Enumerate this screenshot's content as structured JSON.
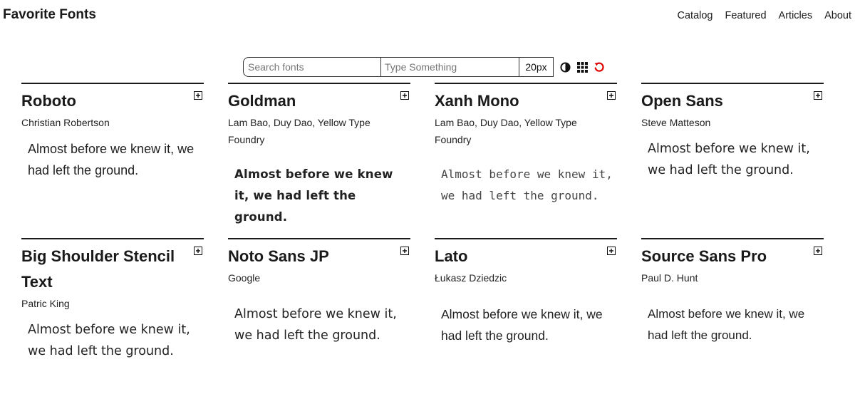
{
  "header": {
    "title": "Favorite Fonts",
    "nav": [
      "Catalog",
      "Featured",
      "Articles",
      "About"
    ]
  },
  "toolbar": {
    "search_placeholder": "Search fonts",
    "sample_placeholder": "Type Something",
    "size_value": "20px",
    "icons": [
      "contrast-icon",
      "grid-icon",
      "reset-icon"
    ],
    "reset_color": "#e00000"
  },
  "cards": [
    {
      "name": "Roboto",
      "author": "Christian Robertson",
      "sample": "Almost before we knew it, we had left the ground."
    },
    {
      "name": "Goldman",
      "author": "Lam Bao, Duy Dao, Yellow Type Foundry",
      "sample": "Almost before we knew it, we had left the ground."
    },
    {
      "name": "Xanh Mono",
      "author": "Lam Bao, Duy Dao, Yellow Type Foundry",
      "sample": "Almost before we knew it, we had left the ground."
    },
    {
      "name": "Open Sans",
      "author": "Steve Matteson",
      "sample": "Almost before we knew it, we had left the ground."
    },
    {
      "name": "Big Shoulder Stencil Text",
      "author": "Patric King",
      "sample": "Almost before we knew it, we had left the ground."
    },
    {
      "name": "Noto Sans JP",
      "author": "Google",
      "sample": "Almost before we knew it, we had left the ground."
    },
    {
      "name": "Lato",
      "author": "Łukasz Dziedzic",
      "sample": "Almost before we knew it, we had left the ground."
    },
    {
      "name": "Source Sans Pro",
      "author": "Paul D. Hunt",
      "sample": "Almost before we knew it, we had left the ground."
    }
  ]
}
